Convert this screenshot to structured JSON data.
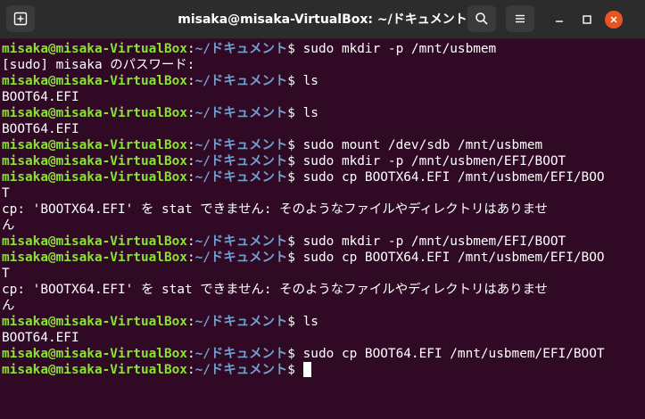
{
  "window": {
    "title": "misaka@misaka-VirtualBox: ~/ドキュメント"
  },
  "icons": {
    "new_tab": "new-tab-icon",
    "search": "search-icon",
    "menu": "hamburger-menu-icon",
    "minimize": "minimize-icon",
    "maximize": "maximize-icon",
    "close": "close-icon"
  },
  "colors": {
    "terminal_bg": "#300a24",
    "user_host": "#8ae234",
    "path": "#729fcf",
    "text": "#ffffff",
    "close_button": "#e95420"
  },
  "prompt": {
    "user_host": "misaka@misaka-VirtualBox",
    "colon": ":",
    "path": "~/ドキュメント",
    "symbol": "$ "
  },
  "lines": [
    {
      "type": "prompt",
      "text": "sudo mkdir -p /mnt/usbmem"
    },
    {
      "type": "output",
      "text": "[sudo] misaka のパスワード:"
    },
    {
      "type": "prompt",
      "text": "ls"
    },
    {
      "type": "output",
      "text": "BOOT64.EFI"
    },
    {
      "type": "prompt",
      "text": "ls"
    },
    {
      "type": "output",
      "text": "BOOT64.EFI"
    },
    {
      "type": "prompt",
      "text": "sudo mount /dev/sdb /mnt/usbmem"
    },
    {
      "type": "prompt",
      "text": "sudo mkdir -p /mnt/usbmen/EFI/BOOT"
    },
    {
      "type": "prompt",
      "text": "sudo cp BOOTX64.EFI /mnt/usbmem/EFI/BOO"
    },
    {
      "type": "output",
      "text": "T"
    },
    {
      "type": "output",
      "text": "cp: 'BOOTX64.EFI' を stat できません: そのようなファイルやディレクトリはありませ"
    },
    {
      "type": "output",
      "text": "ん"
    },
    {
      "type": "prompt",
      "text": "sudo mkdir -p /mnt/usbmem/EFI/BOOT"
    },
    {
      "type": "prompt",
      "text": "sudo cp BOOTX64.EFI /mnt/usbmem/EFI/BOO"
    },
    {
      "type": "output",
      "text": "T"
    },
    {
      "type": "output",
      "text": "cp: 'BOOTX64.EFI' を stat できません: そのようなファイルやディレクトリはありませ"
    },
    {
      "type": "output",
      "text": "ん"
    },
    {
      "type": "prompt",
      "text": "ls"
    },
    {
      "type": "output",
      "text": "BOOT64.EFI"
    },
    {
      "type": "prompt",
      "text": "sudo cp BOOT64.EFI /mnt/usbmem/EFI/BOOT"
    },
    {
      "type": "prompt-active",
      "text": ""
    }
  ]
}
